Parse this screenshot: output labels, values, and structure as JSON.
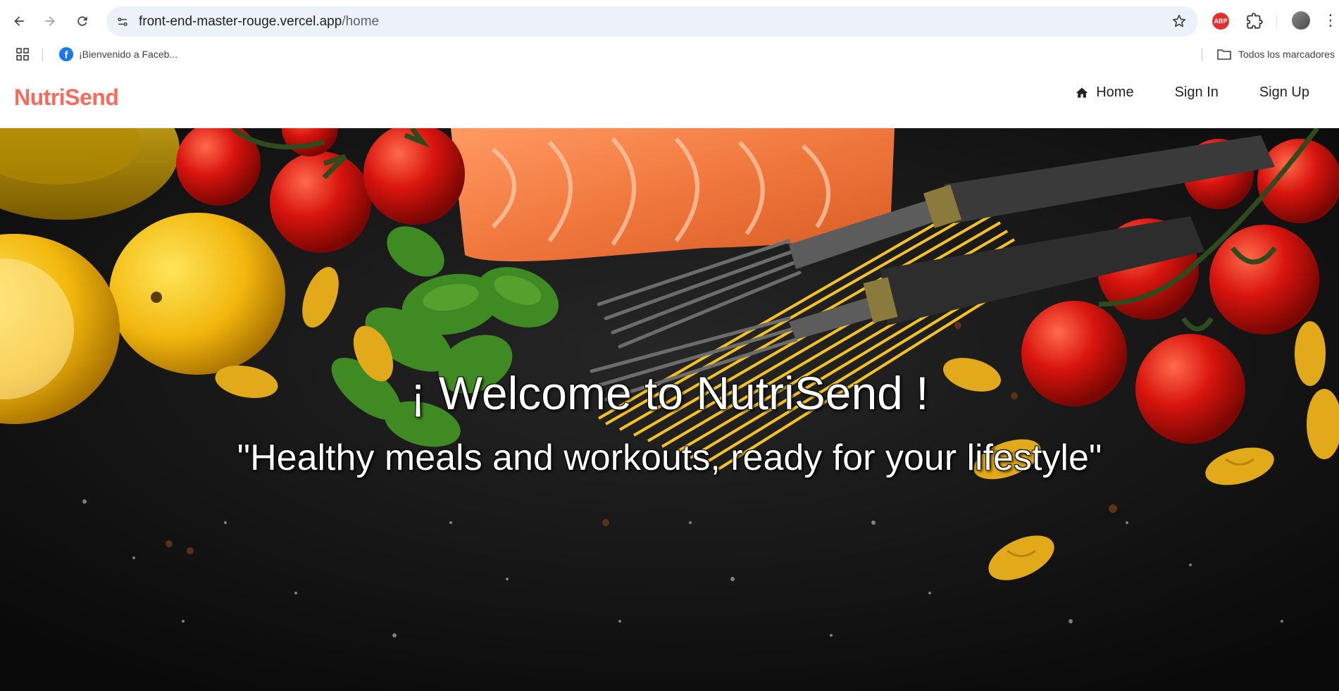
{
  "browser": {
    "url_domain": "front-end-master-rouge.vercel.app",
    "url_path": "/home",
    "icons": [
      "back-icon",
      "forward-icon",
      "reload-icon",
      "site-info-icon",
      "star-icon",
      "adblock-icon",
      "extensions-icon",
      "profile-avatar",
      "menu-icon"
    ],
    "abp_label": "ABP"
  },
  "bookmarks": {
    "items": [
      {
        "label": "¡Bienvenido a Faceb..."
      }
    ],
    "all_bookmarks_label": "Todos los marcadores"
  },
  "site": {
    "brand": "NutriSend",
    "brand_color": "#f76b5e",
    "nav": [
      {
        "label": "Home",
        "icon": "home-icon"
      },
      {
        "label": "Sign In"
      },
      {
        "label": "Sign Up"
      }
    ],
    "hero": {
      "title": "¡ Welcome to NutriSend !",
      "subtitle": "\"Healthy meals and workouts, ready for your lifestyle\""
    }
  }
}
